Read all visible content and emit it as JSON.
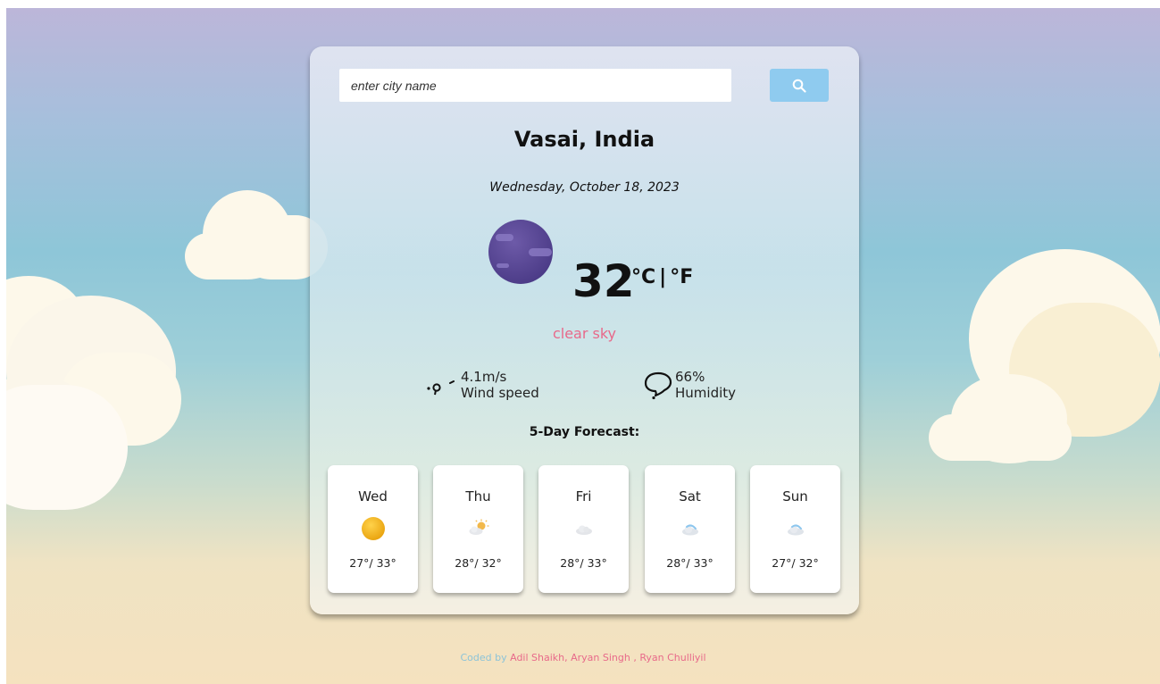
{
  "search": {
    "placeholder": "enter city name",
    "icon": "search-icon"
  },
  "weather": {
    "location": "Vasai, India",
    "date": "Wednesday, October 18, 2023",
    "condition_icon": "moon-icon",
    "temperature": "32",
    "unit_c": "°C",
    "unit_sep": "|",
    "unit_f": "°F",
    "description": "clear sky",
    "wind": {
      "value": "4.1m/s",
      "label": "Wind speed",
      "icon": "wind-icon"
    },
    "humidity": {
      "value": "66%",
      "label": "Humidity",
      "icon": "humidity-icon"
    }
  },
  "forecast": {
    "title": "5-Day Forecast:",
    "days": [
      {
        "day": "Wed",
        "temps": "27°/ 33°",
        "icon": "sun-icon"
      },
      {
        "day": "Thu",
        "temps": "28°/ 32°",
        "icon": "partly-cloudy-icon"
      },
      {
        "day": "Fri",
        "temps": "28°/ 33°",
        "icon": "cloud-icon"
      },
      {
        "day": "Sat",
        "temps": "28°/ 33°",
        "icon": "cloud-icon"
      },
      {
        "day": "Sun",
        "temps": "27°/ 32°",
        "icon": "cloud-icon"
      }
    ]
  },
  "footer": {
    "coded_by": "Coded by",
    "names": "Adil Shaikh, Aryan Singh , Ryan Chulliyil"
  },
  "colors": {
    "accent_pink": "#e8698a",
    "button_blue": "#8fcbef",
    "footer_blue": "#8cc3d8"
  }
}
